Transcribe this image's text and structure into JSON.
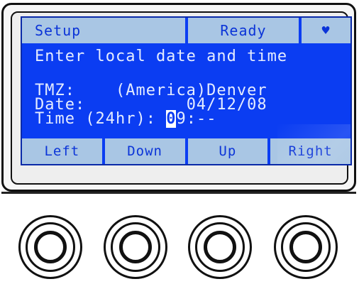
{
  "status_bar": {
    "mode": "Setup",
    "state": "Ready",
    "icon": "heart-icon",
    "icon_glyph": "♥"
  },
  "screen": {
    "prompt": "Enter local date and time",
    "tmz_label": "TMZ:",
    "tmz_value": "(America)Denver",
    "date_label": "Date:",
    "date_value": "04/12/08",
    "time_label": "Time (24hr):",
    "time_cursor_digit": "0",
    "time_rest": "9:--"
  },
  "softkeys": [
    {
      "label": "Left"
    },
    {
      "label": "Down"
    },
    {
      "label": "Up"
    },
    {
      "label": "Right"
    }
  ],
  "colors": {
    "screen_bg": "#0b3df2",
    "bar_bg": "#a9c6e4",
    "text": "#e4ecff"
  }
}
